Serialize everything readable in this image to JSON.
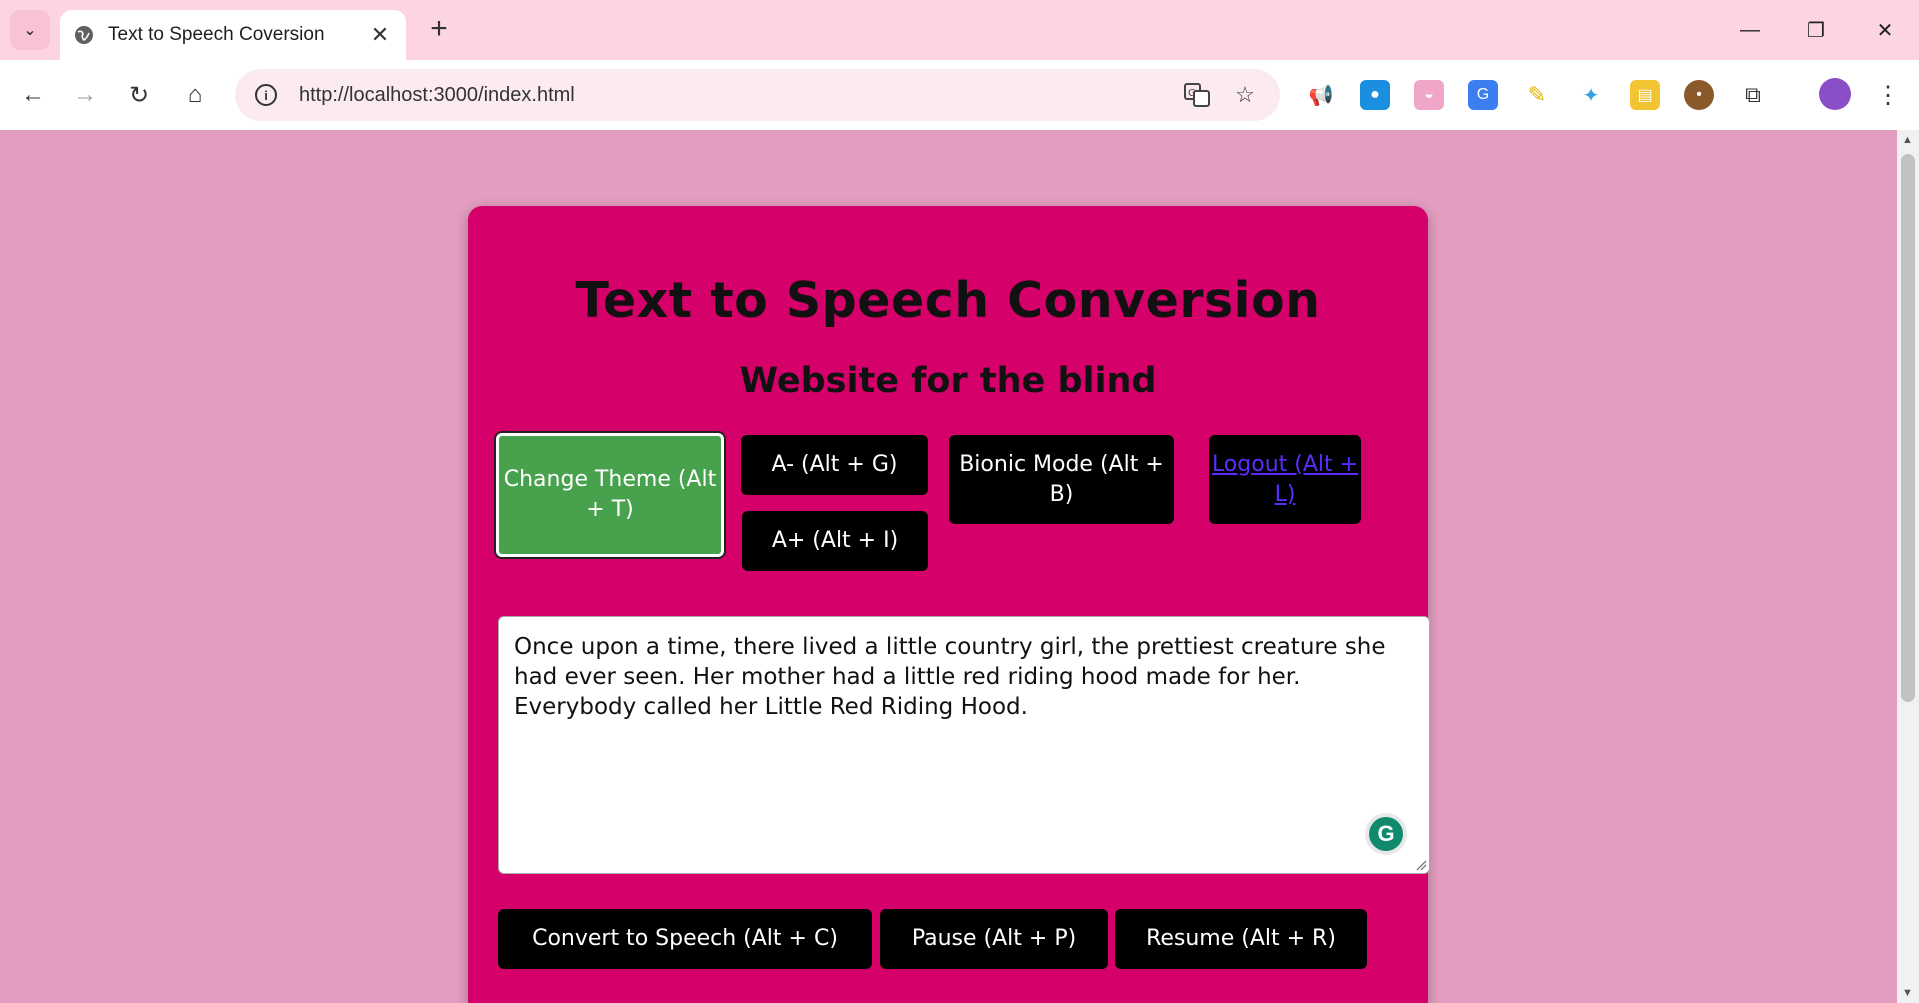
{
  "browser": {
    "tab_title": "Text to Speech Coversion",
    "url": "http://localhost:3000/index.html"
  },
  "page": {
    "heading": "Text to Speech Conversion",
    "subheading": "Website for the blind",
    "buttons": {
      "change_theme": "Change Theme (Alt + T)",
      "font_decrease": "A- (Alt + G)",
      "font_increase": "A+ (Alt + I)",
      "bionic_mode": "Bionic Mode (Alt + B)",
      "logout": "Logout (Alt + L)",
      "convert": "Convert to Speech (Alt + C)",
      "pause": "Pause (Alt + P)",
      "resume": "Resume (Alt + R)"
    },
    "textarea_value": "Once upon a time, there lived a little country girl, the prettiest creature she had ever seen. Her mother had a little red riding hood made for her. Everybody called her Little Red Riding Hood."
  },
  "colors": {
    "page_background": "#e39dc0",
    "card_background": "#d6006a",
    "theme_button": "#48a24d",
    "button": "#000000",
    "logout_link": "#5a2cff"
  },
  "icons": {
    "tab_favicon": "globe-icon",
    "grammarly": "grammarly-icon"
  }
}
